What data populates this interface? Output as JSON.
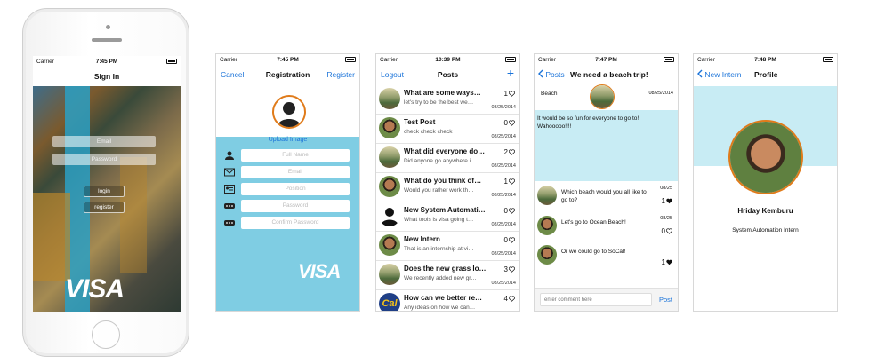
{
  "status": {
    "carrier": "Carrier"
  },
  "signin": {
    "time": "7:45 PM",
    "title": "Sign In",
    "email_placeholder": "Email",
    "password_placeholder": "Password",
    "login_label": "login",
    "register_label": "register",
    "brand": "VISA"
  },
  "registration": {
    "time": "7:45 PM",
    "title": "Registration",
    "cancel_label": "Cancel",
    "register_label": "Register",
    "upload_label": "Upload Image",
    "fields": [
      "Full Name",
      "Email",
      "Position",
      "Password",
      "Confirm Password"
    ],
    "brand": "VISA"
  },
  "posts": {
    "time": "10:39 PM",
    "title": "Posts",
    "logout_label": "Logout",
    "add_label": "+",
    "items": [
      {
        "title": "What are some ways…",
        "preview": "let's try to be the best we…",
        "count": "1",
        "date": "08/25/2014"
      },
      {
        "title": "Test Post",
        "preview": "check check check",
        "count": "0",
        "date": "08/25/2014"
      },
      {
        "title": "What did everyone do…",
        "preview": "Did anyone go anywhere i…",
        "count": "2",
        "date": "08/25/2014"
      },
      {
        "title": "What do you think of…",
        "preview": "Would you rather work th…",
        "count": "1",
        "date": "08/25/2014"
      },
      {
        "title": "New System Automati…",
        "preview": "What tools is visa going t…",
        "count": "0",
        "date": "08/25/2014"
      },
      {
        "title": "New Intern",
        "preview": "That is an internship at vi…",
        "count": "0",
        "date": "08/25/2014"
      },
      {
        "title": "Does the new grass lo…",
        "preview": "We recently added new gr…",
        "count": "3",
        "date": "08/25/2014"
      },
      {
        "title": "How can we better re…",
        "preview": "Any ideas on how we can…",
        "count": "4",
        "date": "08/25/2014"
      }
    ]
  },
  "thread": {
    "time": "7:47 PM",
    "back_label": "Posts",
    "title": "We need a beach trip!",
    "topic": "Beach",
    "date": "08/25/2014",
    "body": "It would be so fun for everyone to go to! Wahooooo!!!!",
    "comments": [
      {
        "text": "Which beach would you all like to go to?",
        "date": "08/25",
        "likes": "1"
      },
      {
        "text": "Let's go to Ocean Beach!",
        "date": "08/25",
        "likes": "0"
      },
      {
        "text": "Or we could go to SoCal!",
        "date": "08/25",
        "likes": "1"
      }
    ],
    "comment_placeholder": "enter comment here",
    "post_label": "Post"
  },
  "profile": {
    "time": "7:48 PM",
    "back_label": "New Intern",
    "title": "Profile",
    "name": "Hriday Kemburu",
    "role": "System Automation Intern"
  }
}
